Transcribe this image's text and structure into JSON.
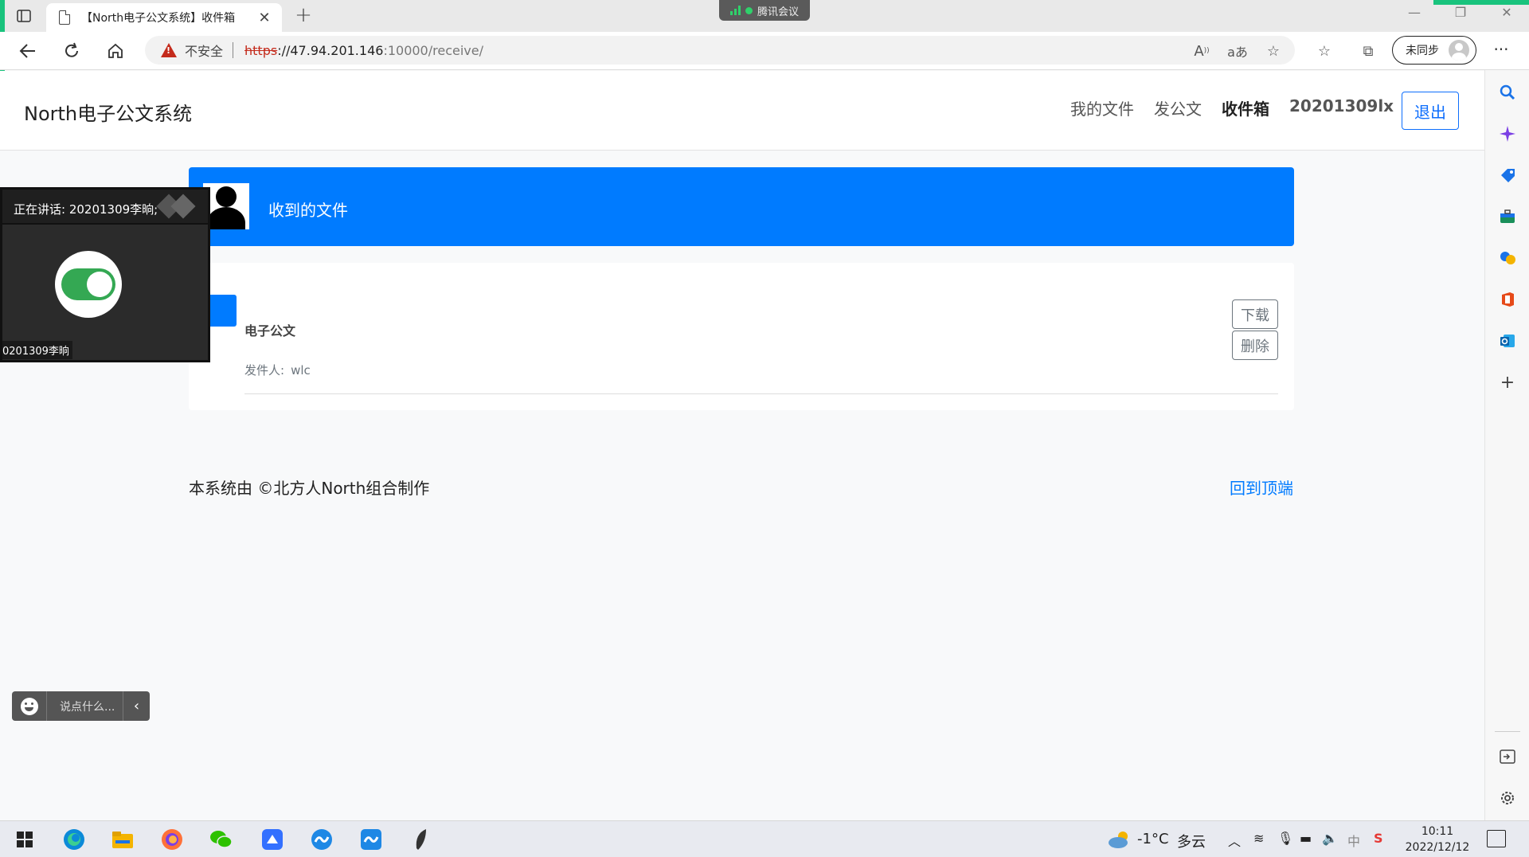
{
  "browser": {
    "tab_title": "【North电子公文系统】收件箱",
    "meeting_label": "腾讯会议",
    "security_label": "不安全",
    "url_proto": "https",
    "url_host": "://47.94.201.146",
    "url_path": ":10000/receive/",
    "sync_label": "未同步"
  },
  "site": {
    "brand": "North电子公文系统",
    "nav": {
      "my_files": "我的文件",
      "send_doc": "发公文",
      "inbox": "收件箱",
      "username": "20201309lx",
      "logout": "退出"
    },
    "header_title": "收到的文件",
    "documents": [
      {
        "title": "电子公文",
        "sender_label": "发件人:",
        "sender": "wlc",
        "download_label": "下载",
        "delete_label": "删除"
      }
    ],
    "footer_left": "本系统由 ©北方人North组合制作",
    "footer_right": "回到顶端"
  },
  "meeting": {
    "speaking": "正在讲话: 20201309李晌;",
    "participant_name": "0201309李晌",
    "chat_placeholder": "说点什么..."
  },
  "taskbar": {
    "weather_temp": "-1°C",
    "weather_desc": "多云",
    "ime": "中",
    "time": "10:11",
    "date": "2022/12/12"
  },
  "colors": {
    "primary": "#007bff",
    "insecure_red": "#c42b1c",
    "meeting_green": "#34a853"
  }
}
